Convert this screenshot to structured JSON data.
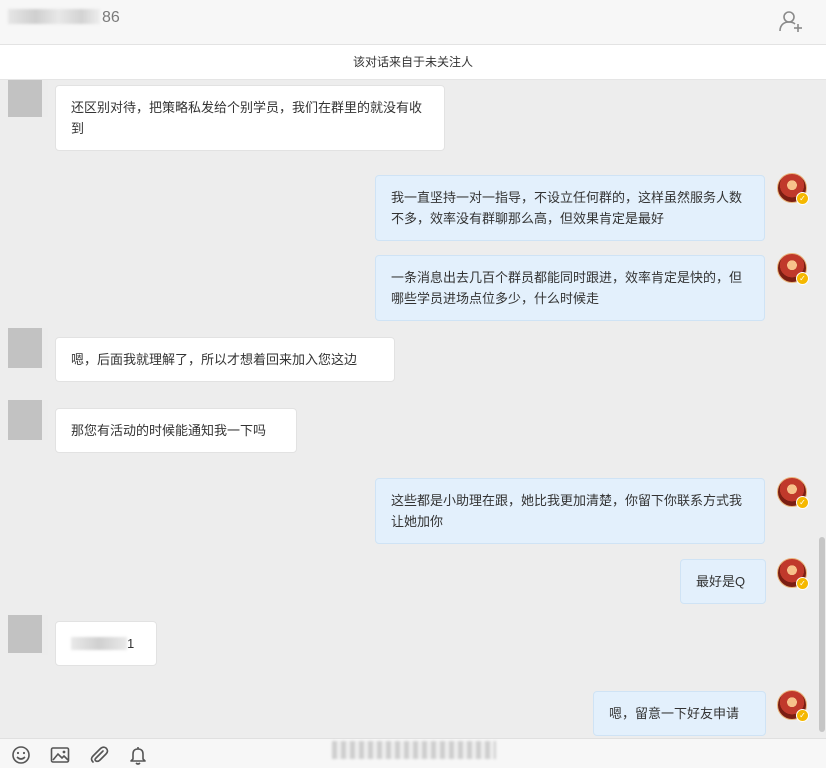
{
  "header": {
    "contact_name_visible": "86",
    "add_contact_icon": "add-contact-icon"
  },
  "notice": {
    "text": "该对话来自于未关注人"
  },
  "messages": [
    {
      "side": "left",
      "text": "还区别对待，把策略私发给个别学员，我们在群里的就没有收到"
    },
    {
      "side": "right",
      "text": "我一直坚持一对一指导，不设立任何群的，这样虽然服务人数不多，效率没有群聊那么高，但效果肯定是最好"
    },
    {
      "side": "right",
      "text": "一条消息出去几百个群员都能同时跟进，效率肯定是快的，但哪些学员进场点位多少，什么时候走"
    },
    {
      "side": "left",
      "text": "嗯，后面我就理解了，所以才想着回来加入您这边"
    },
    {
      "side": "left",
      "text": "那您有活动的时候能通知我一下吗"
    },
    {
      "side": "right",
      "text": "这些都是小助理在跟，她比我更加清楚，你留下你联系方式我让她加你"
    },
    {
      "side": "right",
      "text": "最好是Q"
    },
    {
      "side": "left",
      "text": "1"
    },
    {
      "side": "right",
      "text": "嗯，留意一下好友申请"
    }
  ],
  "toolbar": {
    "icons": [
      "emoji-icon",
      "image-icon",
      "attachment-icon",
      "bell-icon"
    ]
  },
  "colors": {
    "chat_background": "#ededed",
    "incoming_bubble": "#ffffff",
    "outgoing_bubble": "#e3f0fc",
    "verified_badge": "#f5b800"
  }
}
